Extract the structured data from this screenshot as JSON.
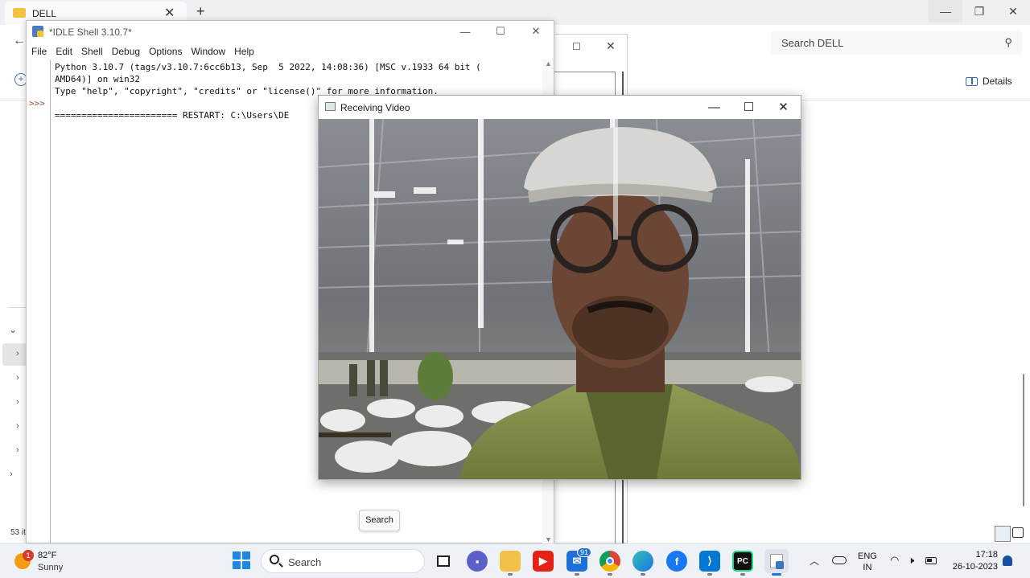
{
  "explorer": {
    "tab_title": "DELL",
    "search_placeholder": "Search DELL",
    "details_label": "Details",
    "item_count": "53 it"
  },
  "idle": {
    "title": "*IDLE Shell 3.10.7*",
    "menu": [
      "File",
      "Edit",
      "Shell",
      "Debug",
      "Options",
      "Window",
      "Help"
    ],
    "lines": [
      "Python 3.10.7 (tags/v3.10.7:6cc6b13, Sep  5 2022, 14:08:36) [MSC v.1933 64 bit (",
      "AMD64)] on win32",
      "Type \"help\", \"copyright\", \"credits\" or \"license()\" for more information.",
      "",
      "======================= RESTART: C:\\Users\\DE"
    ],
    "prompt": ">>>"
  },
  "video_window": {
    "title": "Receiving Video"
  },
  "tooltip": {
    "text": "Search"
  },
  "taskbar": {
    "weather_badge": "1",
    "temperature": "82°F",
    "condition": "Sunny",
    "search_placeholder": "Search",
    "mail_badge": "91",
    "lang_top": "ENG",
    "lang_bottom": "IN",
    "time": "17:18",
    "date": "26-10-2023"
  },
  "icons": {
    "taskbar_apps": [
      "start-icon",
      "search-icon",
      "task-view-icon",
      "teams-icon",
      "file-explorer-icon",
      "youtube-icon",
      "mail-icon",
      "chrome-icon",
      "edge-icon",
      "facebook-icon",
      "vscode-icon",
      "pycharm-icon",
      "python-idle-icon"
    ]
  }
}
